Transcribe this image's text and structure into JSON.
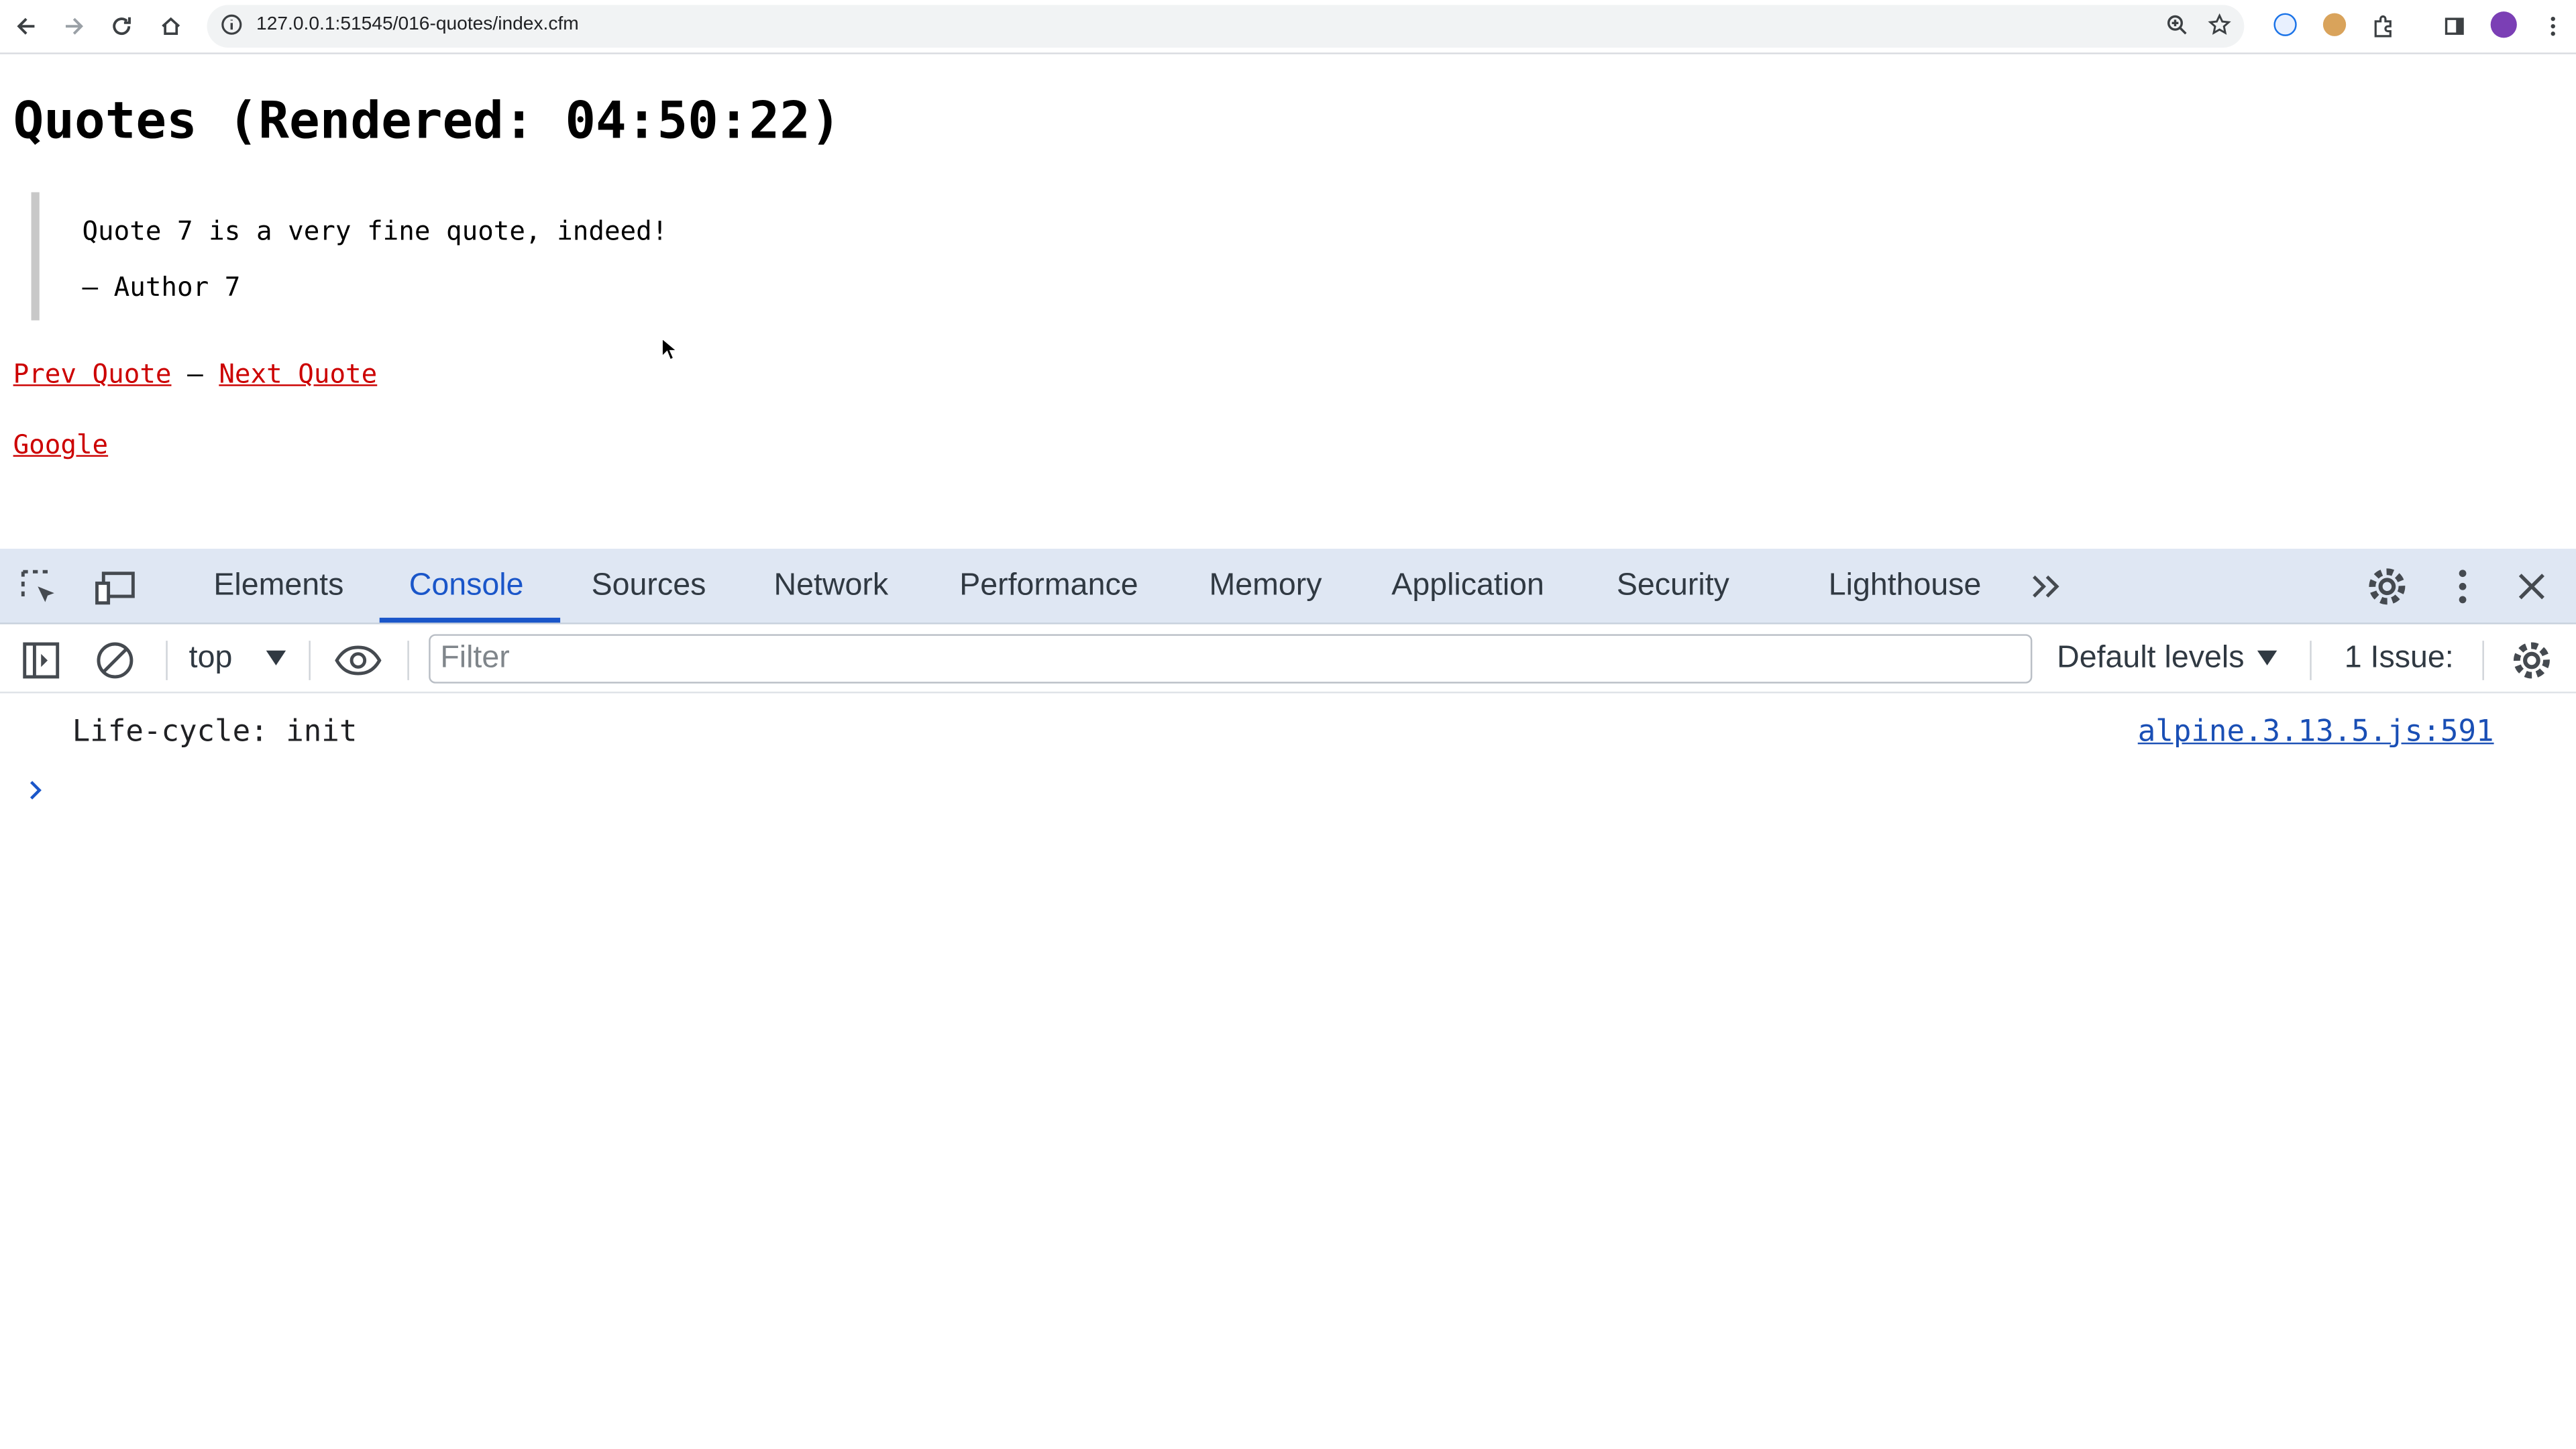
{
  "browser": {
    "url": "127.0.0.1:51545/016-quotes/index.cfm"
  },
  "page": {
    "title": "Quotes (Rendered: 04:50:22)",
    "quote_text": "Quote 7 is a very fine quote, indeed!",
    "quote_author": "— Author 7",
    "prev_link": "Prev Quote",
    "separator": "–",
    "next_link": "Next Quote",
    "google_link": "Google"
  },
  "devtools": {
    "tabs": [
      "Elements",
      "Console",
      "Sources",
      "Network",
      "Performance",
      "Memory",
      "Application",
      "Security",
      "Lighthouse"
    ],
    "active_tab": "Console",
    "context": "top",
    "filter_placeholder": "Filter",
    "levels": "Default levels",
    "issues": "1 Issue:",
    "log": {
      "message": "Life-cycle: init",
      "source": "alpine.3.13.5.js:591"
    }
  }
}
